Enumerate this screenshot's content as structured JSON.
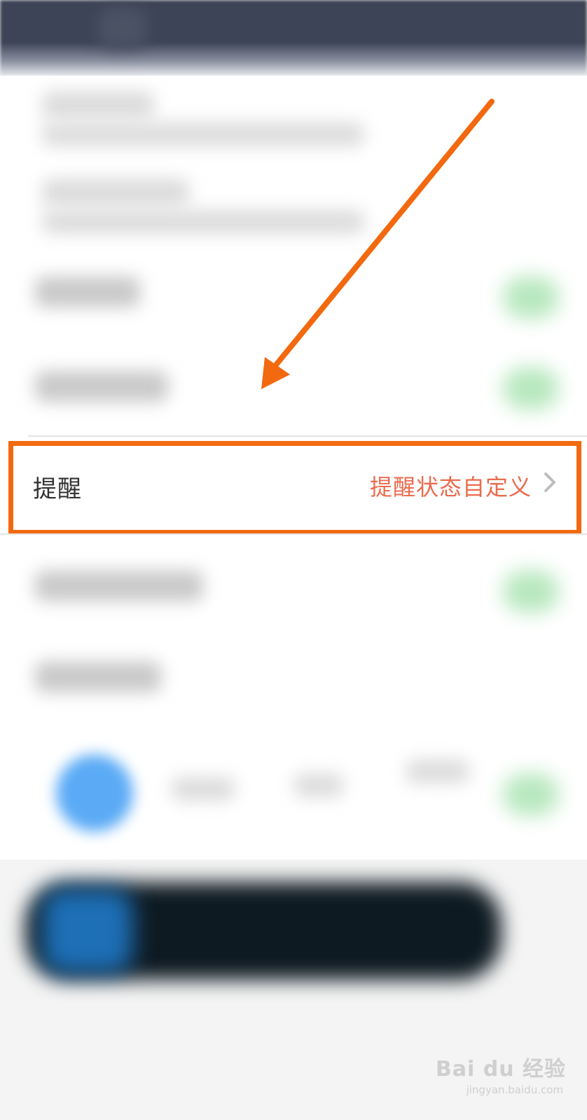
{
  "settings_row": {
    "label": "提醒",
    "value": "提醒状态自定义"
  },
  "colors": {
    "highlight": "#f2690f",
    "value_text": "#ea6b4d",
    "label_text": "#333333"
  },
  "icons": {
    "chevron": "chevron-right-icon",
    "arrow": "annotation-arrow"
  },
  "watermark": {
    "main": "Bai du 经验",
    "sub": "jingyan.baidu.com"
  }
}
